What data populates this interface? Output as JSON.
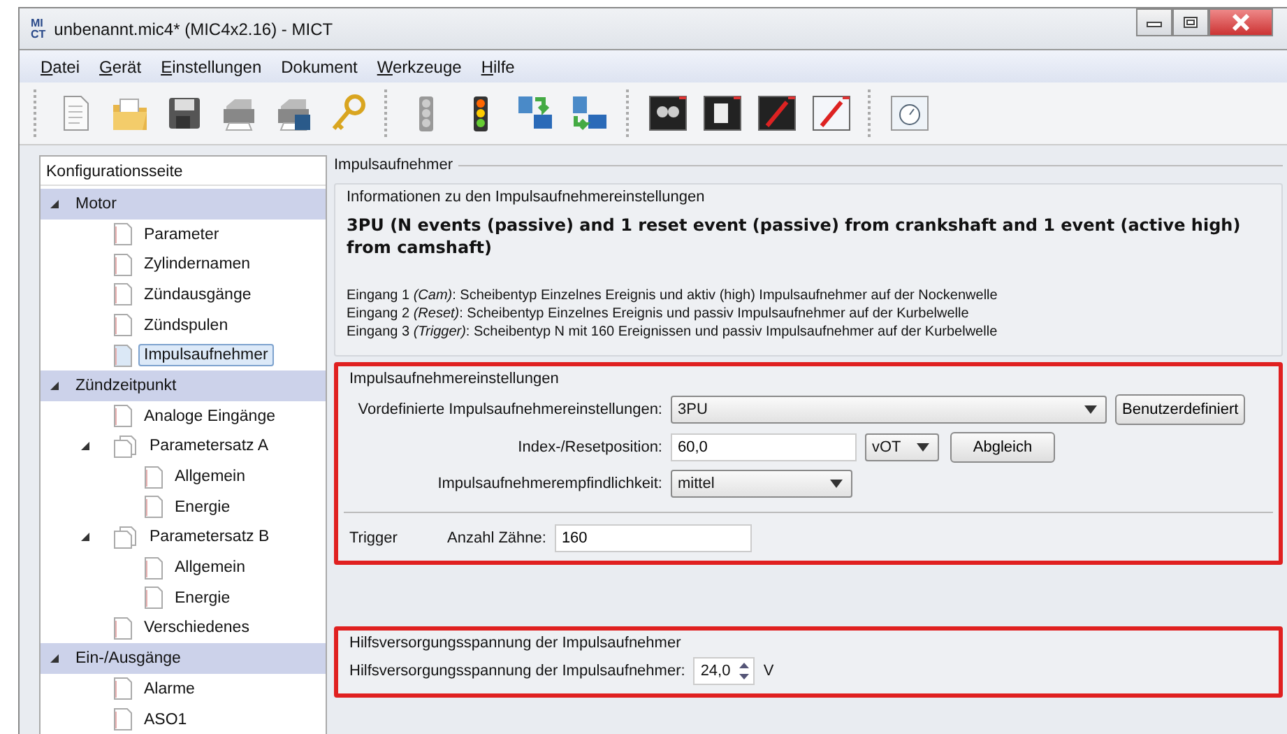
{
  "window": {
    "logo": [
      "MI",
      "CT"
    ],
    "title": "unbenannt.mic4* (MIC4x2.16) - MICT"
  },
  "menu": [
    {
      "label": "Datei",
      "accel": true
    },
    {
      "label": "Gerät",
      "accel": true
    },
    {
      "label": "Einstellungen",
      "accel": true
    },
    {
      "label": "Dokument",
      "accel": false
    },
    {
      "label": "Werkzeuge",
      "accel": true
    },
    {
      "label": "Hilfe",
      "accel": true
    }
  ],
  "sidebar": {
    "title": "Konfigurationsseite",
    "items": [
      {
        "label": "Motor",
        "kind": "category",
        "expanded": true,
        "selected": false,
        "children": [
          {
            "label": "Parameter",
            "kind": "page",
            "selected": false
          },
          {
            "label": "Zylindernamen",
            "kind": "page",
            "selected": false
          },
          {
            "label": "Zündausgänge",
            "kind": "page",
            "selected": false
          },
          {
            "label": "Zündspulen",
            "kind": "page",
            "selected": false
          },
          {
            "label": "Impulsaufnehmer",
            "kind": "page",
            "selected": true
          }
        ]
      },
      {
        "label": "Zündzeitpunkt",
        "kind": "category",
        "expanded": true,
        "selected": false,
        "children": [
          {
            "label": "Analoge Eingänge",
            "kind": "page",
            "selected": false
          },
          {
            "label": "Parametersatz A",
            "kind": "group",
            "expanded": true,
            "selected": false,
            "children": [
              {
                "label": "Allgemein",
                "kind": "page",
                "selected": false
              },
              {
                "label": "Energie",
                "kind": "page",
                "selected": false
              }
            ]
          },
          {
            "label": "Parametersatz B",
            "kind": "group",
            "expanded": true,
            "selected": false,
            "children": [
              {
                "label": "Allgemein",
                "kind": "page",
                "selected": false
              },
              {
                "label": "Energie",
                "kind": "page",
                "selected": false
              }
            ]
          },
          {
            "label": "Verschiedenes",
            "kind": "page",
            "selected": false
          }
        ]
      },
      {
        "label": "Ein-/Ausgänge",
        "kind": "category",
        "expanded": true,
        "selected": false,
        "children": [
          {
            "label": "Alarme",
            "kind": "page",
            "selected": false
          },
          {
            "label": "ASO1",
            "kind": "page",
            "selected": false
          }
        ]
      }
    ]
  },
  "panel": {
    "title": "Impulsaufnehmer",
    "info": {
      "title": "Informationen zu den Impulsaufnehmereinstellungen",
      "headline": "3PU (N events (passive) and 1 reset event (passive) from crankshaft and 1 event (active high) from camshaft)",
      "lines": [
        "Eingang 1 *(Cam)*: Scheibentyp Einzelnes Ereignis und aktiv (high) Impulsaufnehmer auf der Nockenwelle",
        "Eingang 2 *(Reset)*: Scheibentyp Einzelnes Ereignis und passiv Impulsaufnehmer auf der Kurbelwelle",
        "Eingang 3 *(Trigger)*: Scheibentyp N mit 160 Ereignissen und passiv Impulsaufnehmer auf der Kurbelwelle"
      ]
    },
    "settings": {
      "title": "Impulsaufnehmereinstellungen",
      "highlighted": true,
      "preset": {
        "label": "Vordefinierte Impulsaufnehmereinstellungen:",
        "value": "3PU",
        "button": "Benutzerdefiniert"
      },
      "index": {
        "label": "Index-/Resetposition:",
        "value": "60,0",
        "unit": "vOT",
        "button": "Abgleich"
      },
      "sensitivity": {
        "label": "Impulsaufnehmerempfindlichkeit:",
        "value": "mittel"
      },
      "trigger": {
        "label": "Trigger",
        "teeth_label": "Anzahl Zähne:",
        "teeth": "160"
      }
    },
    "supply": {
      "title": "Hilfsversorgungsspannung der Impulsaufnehmer",
      "highlighted": true,
      "label": "Hilfsversorgungsspannung der Impulsaufnehmer:",
      "value": "24,0",
      "unit": "V"
    }
  }
}
